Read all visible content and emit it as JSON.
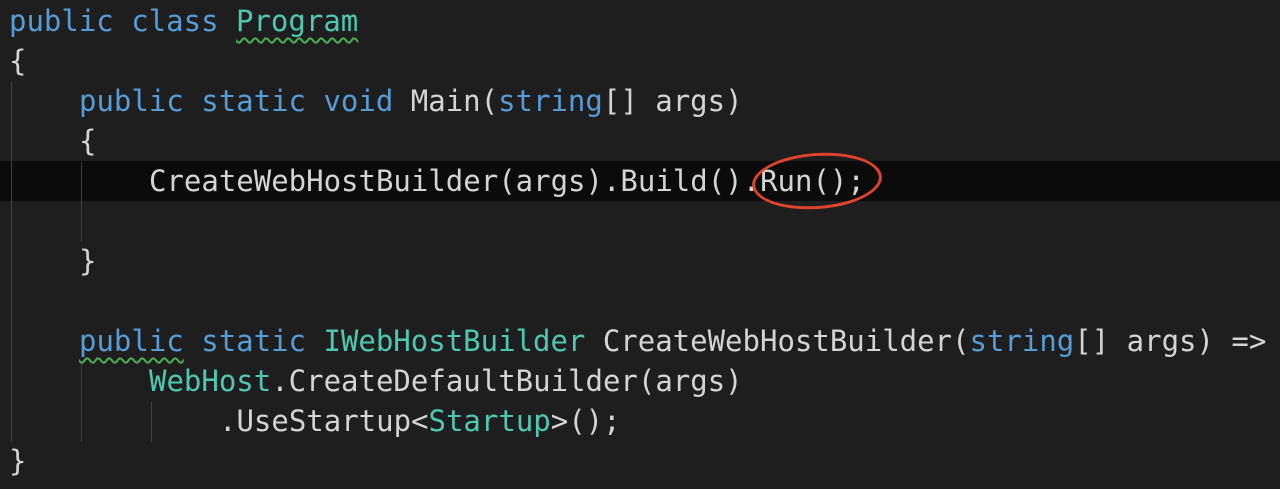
{
  "code": {
    "line1": {
      "kw1": "public",
      "kw2": "class",
      "name": "Program"
    },
    "line2": {
      "brace": "{"
    },
    "line3": {
      "kw1": "public",
      "kw2": "static",
      "kw3": "void",
      "rest1": "Main(",
      "type": "string",
      "rest2": "[] args)"
    },
    "line4": {
      "brace": "{"
    },
    "line5": {
      "pre": "CreateWebHostBuilder(args).Build()",
      "post": ".Run();"
    },
    "line7": {
      "brace": "}"
    },
    "line9": {
      "kw1": "public",
      "kw2": "static",
      "type1": "IWebHostBuilder",
      "rest1": "CreateWebHostBuilder(",
      "type2": "string",
      "rest2": "[] args) =>"
    },
    "line10": {
      "type": "WebHost",
      "rest": ".CreateDefaultBuilder(args)"
    },
    "line11": {
      "pre": ".UseStartup<",
      "type": "Startup",
      "post": ">();"
    },
    "line12": {
      "brace": "}"
    }
  },
  "colors": {
    "background": "#1e1e1e",
    "keyword": "#569cd6",
    "type": "#4ec9b0",
    "text": "#d4d4d4",
    "annotation": "#e0442c",
    "squiggle": "#4caf50"
  }
}
